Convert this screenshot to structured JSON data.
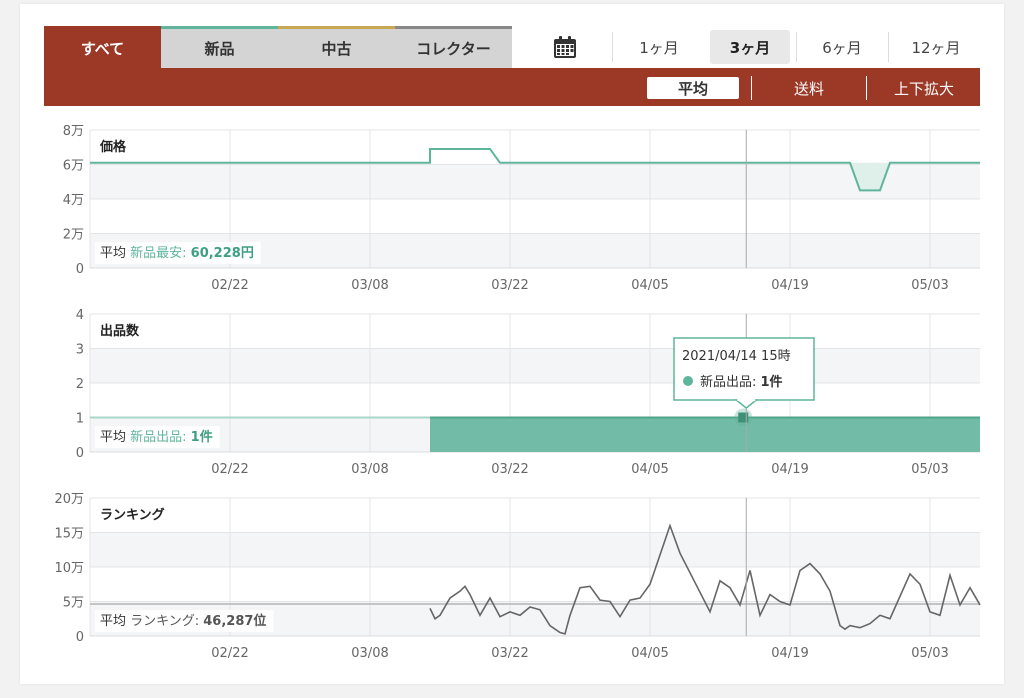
{
  "tabs": [
    {
      "label": "すべて",
      "active": true
    },
    {
      "label": "新品",
      "active": false,
      "color": "#5fb59b"
    },
    {
      "label": "中古",
      "active": false,
      "color": "#c8a852"
    },
    {
      "label": "コレクター",
      "active": false,
      "color": "#888888"
    }
  ],
  "range_icon": "calendar-icon",
  "ranges": [
    {
      "label": "1ヶ月",
      "active": false
    },
    {
      "label": "3ヶ月",
      "active": true
    },
    {
      "label": "6ヶ月",
      "active": false
    },
    {
      "label": "12ヶ月",
      "active": false
    }
  ],
  "options": [
    {
      "label": "平均",
      "active": true
    },
    {
      "label": "送料",
      "active": false
    },
    {
      "label": "上下拡大",
      "active": false
    }
  ],
  "colors": {
    "brand": "#9b3826",
    "new": "#5fb59b",
    "ranking": "#666666"
  },
  "chart_data": [
    {
      "type": "line",
      "title": "価格",
      "y_ticks": [
        "0",
        "2万",
        "4万",
        "6万",
        "8万"
      ],
      "ylim": [
        0,
        80000
      ],
      "x_ticks": [
        "02/22",
        "03/08",
        "03/22",
        "04/05",
        "04/19",
        "05/03"
      ],
      "series": [
        {
          "name": "新品",
          "color": "#5fb59b",
          "x": [
            "2021-02-08",
            "2021-03-14",
            "2021-03-14",
            "2021-03-20",
            "2021-03-21",
            "2021-04-25",
            "2021-04-26",
            "2021-04-28",
            "2021-04-29",
            "2021-05-08"
          ],
          "values": [
            61000,
            61000,
            69000,
            69000,
            61000,
            61000,
            45000,
            45000,
            61000,
            61000
          ]
        }
      ],
      "average": {
        "prefix": "平均",
        "label": "新品最安:",
        "value": "60,228円"
      }
    },
    {
      "type": "area",
      "title": "出品数",
      "y_ticks": [
        "0",
        "1",
        "2",
        "3",
        "4"
      ],
      "ylim": [
        0,
        4
      ],
      "x_ticks": [
        "02/22",
        "03/08",
        "03/22",
        "04/05",
        "04/19",
        "05/03"
      ],
      "series": [
        {
          "name": "新品出品",
          "color": "#5fb59b",
          "x": [
            "2021-03-14",
            "2021-05-08"
          ],
          "values": [
            1,
            1
          ]
        }
      ],
      "tooltip": {
        "date": "2021/04/14 15時",
        "label": "新品出品:",
        "value": "1件"
      },
      "average": {
        "prefix": "平均",
        "label": "新品出品:",
        "value": "1件"
      }
    },
    {
      "type": "line",
      "title": "ランキング",
      "y_ticks": [
        "0",
        "5万",
        "10万",
        "15万",
        "20万"
      ],
      "ylim": [
        0,
        200000
      ],
      "x_ticks": [
        "02/22",
        "03/08",
        "03/22",
        "04/05",
        "04/19",
        "05/03"
      ],
      "series": [
        {
          "name": "ランキング",
          "color": "#666666",
          "x": [
            "2021-03-14",
            "2021-03-14 12:00",
            "2021-03-15",
            "2021-03-16",
            "2021-03-17",
            "2021-03-17 12:00",
            "2021-03-18",
            "2021-03-19",
            "2021-03-20",
            "2021-03-21",
            "2021-03-22",
            "2021-03-23",
            "2021-03-24",
            "2021-03-25",
            "2021-03-26",
            "2021-03-27",
            "2021-03-27 12:00",
            "2021-03-28",
            "2021-03-29",
            "2021-03-30",
            "2021-03-31",
            "2021-04-01",
            "2021-04-02",
            "2021-04-03",
            "2021-04-04",
            "2021-04-05",
            "2021-04-07",
            "2021-04-08",
            "2021-04-11",
            "2021-04-12",
            "2021-04-13",
            "2021-04-14",
            "2021-04-15",
            "2021-04-16",
            "2021-04-17",
            "2021-04-18",
            "2021-04-19",
            "2021-04-20",
            "2021-04-21",
            "2021-04-22",
            "2021-04-23",
            "2021-04-24",
            "2021-04-24 12:00",
            "2021-04-25",
            "2021-04-26",
            "2021-04-27",
            "2021-04-28",
            "2021-04-29",
            "2021-05-01",
            "2021-05-02",
            "2021-05-03",
            "2021-05-04",
            "2021-05-05",
            "2021-05-06",
            "2021-05-07",
            "2021-05-08"
          ],
          "values": [
            40000,
            25000,
            30000,
            55000,
            65000,
            72000,
            60000,
            30000,
            55000,
            28000,
            35000,
            30000,
            42000,
            38000,
            15000,
            5000,
            3000,
            30000,
            70000,
            72000,
            52000,
            50000,
            28000,
            52000,
            55000,
            75000,
            160000,
            120000,
            35000,
            80000,
            70000,
            45000,
            95000,
            30000,
            60000,
            50000,
            45000,
            95000,
            105000,
            90000,
            65000,
            15000,
            10000,
            15000,
            12000,
            18000,
            30000,
            25000,
            90000,
            75000,
            35000,
            30000,
            88000,
            45000,
            70000,
            45000
          ]
        }
      ],
      "average": {
        "prefix": "平均",
        "label": "ランキング:",
        "value": "46,287位"
      }
    }
  ]
}
